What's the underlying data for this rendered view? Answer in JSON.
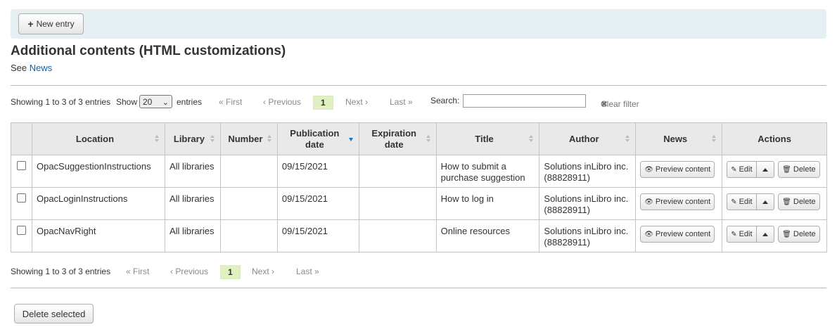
{
  "toolbar": {
    "new_entry_label": "New entry"
  },
  "page": {
    "title": "Additional contents (HTML customizations)",
    "see_prefix": "See",
    "see_link": "News"
  },
  "top_controls": {
    "info": "Showing 1 to 3 of 3 entries",
    "show_label": "Show",
    "show_value": "20",
    "entries_label": "entries",
    "first": "« First",
    "previous": "‹ Previous",
    "current_page": "1",
    "next": "Next ›",
    "last": "Last »",
    "search_label": "Search:",
    "search_value": "",
    "clear_filter": "Clear filter"
  },
  "bottom_controls": {
    "info": "Showing 1 to 3 of 3 entries",
    "first": "« First",
    "previous": "‹ Previous",
    "current_page": "1",
    "next": "Next ›",
    "last": "Last »"
  },
  "table": {
    "columns": [
      {
        "label": ""
      },
      {
        "label": "Location"
      },
      {
        "label": "Library"
      },
      {
        "label": "Number"
      },
      {
        "label": "Publication date"
      },
      {
        "label": "Expiration date"
      },
      {
        "label": "Title"
      },
      {
        "label": "Author"
      },
      {
        "label": "News"
      },
      {
        "label": "Actions"
      }
    ],
    "rows": [
      {
        "location": "OpacSuggestionInstructions",
        "library": "All libraries",
        "number": "",
        "publication_date": "09/15/2021",
        "expiration_date": "",
        "title": "How to submit a purchase suggestion",
        "author": "Solutions inLibro inc. (88828911)"
      },
      {
        "location": "OpacLoginInstructions",
        "library": "All libraries",
        "number": "",
        "publication_date": "09/15/2021",
        "expiration_date": "",
        "title": "How to log in",
        "author": "Solutions inLibro inc. (88828911)"
      },
      {
        "location": "OpacNavRight",
        "library": "All libraries",
        "number": "",
        "publication_date": "09/15/2021",
        "expiration_date": "",
        "title": "Online resources",
        "author": "Solutions inLibro inc. (88828911)"
      }
    ],
    "preview_label": "Preview content",
    "edit_label": "Edit",
    "delete_label": "Delete"
  },
  "footer": {
    "delete_selected_label": "Delete selected"
  },
  "colors": {
    "toolbar_bg": "#e6f0f2",
    "link": "#0f5fa8",
    "current_page_bg": "#e0f0c0",
    "sort_active": "#1a76c0"
  }
}
